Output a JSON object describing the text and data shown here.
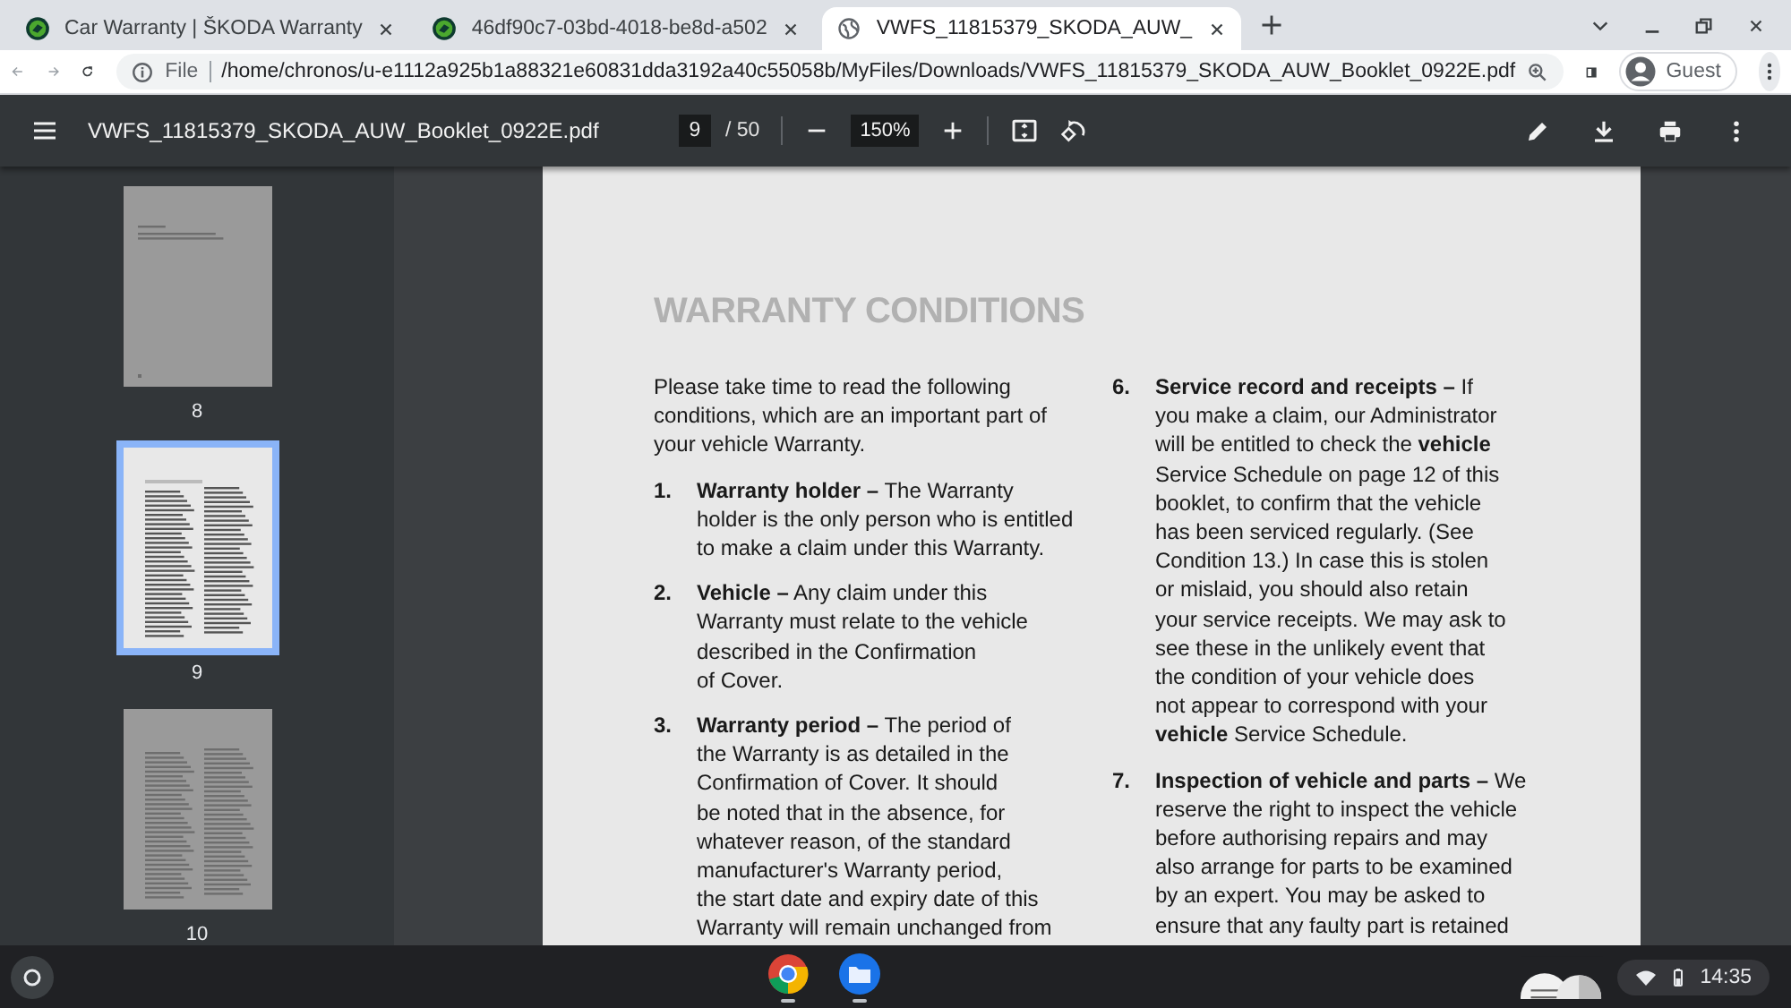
{
  "tabs": [
    {
      "kind": "skoda",
      "title": "Car Warranty | ŠKODA Warranty",
      "selected": false
    },
    {
      "kind": "skoda",
      "title": "46df90c7-03bd-4018-be8d-a502",
      "selected": false
    },
    {
      "kind": "globe",
      "title": "VWFS_11815379_SKODA_AUW_",
      "selected": true
    }
  ],
  "address_bar": {
    "scheme": "File",
    "url": "/home/chronos/u-e1112a925b1a88321e60831dda3192a40c55058b/MyFiles/Downloads/VWFS_11815379_SKODA_AUW_Booklet_0922E.pdf"
  },
  "profile": {
    "label": "Guest"
  },
  "pdf_toolbar": {
    "filename": "VWFS_11815379_SKODA_AUW_Booklet_0922E.pdf",
    "page": "9",
    "page_total": "/ 50",
    "zoom": "150%"
  },
  "thumbnails": [
    {
      "label": "8",
      "selected": false
    },
    {
      "label": "9",
      "selected": true
    },
    {
      "label": "10",
      "selected": false
    }
  ],
  "document": {
    "title": "WARRANTY CONDITIONS",
    "columns": [
      [
        {
          "kind": "para",
          "text": "Please take time to read the following\nconditions, which are an important part of\nyour vehicle Warranty."
        },
        {
          "kind": "item",
          "number": "1.",
          "text": "**Warranty holder –** The Warranty\nholder is the only person who is entitled\nto make a claim under this Warranty."
        },
        {
          "kind": "item",
          "number": "2.",
          "text": "**Vehicle –** Any claim under this\nWarranty must relate to the vehicle\ndescribed in the Confirmation\nof Cover."
        },
        {
          "kind": "item",
          "number": "3.",
          "text": "**Warranty period –** The period of\nthe Warranty is as detailed in the\nConfirmation of Cover. It should\nbe noted that in the absence, for\nwhatever reason, of the standard\nmanufacturer's Warranty period,\nthe start date and expiry date of this\nWarranty will remain unchanged from"
        }
      ],
      [
        {
          "kind": "item",
          "number": "6.",
          "text": "**Service record and receipts –** If\nyou make a claim, our Administrator\nwill be entitled to check the **vehicle**\nService Schedule on page 12 of this\nbooklet, to confirm that the vehicle\nhas been serviced regularly. (See\nCondition 13.) In case this is stolen\nor mislaid, you should also retain\nyour service receipts. We may ask to\nsee these in the unlikely event that\nthe condition of your vehicle does\nnot appear to correspond with your\n**vehicle** Service Schedule."
        },
        {
          "kind": "item",
          "number": "7.",
          "text": "**Inspection of vehicle and parts –** We\nreserve the right to inspect the vehicle\nbefore authorising repairs and may\nalso arrange for parts to be examined\nby an expert. You may be asked to\nensure that any faulty part is retained"
        }
      ]
    ]
  },
  "shelf": {
    "time": "14:35"
  }
}
